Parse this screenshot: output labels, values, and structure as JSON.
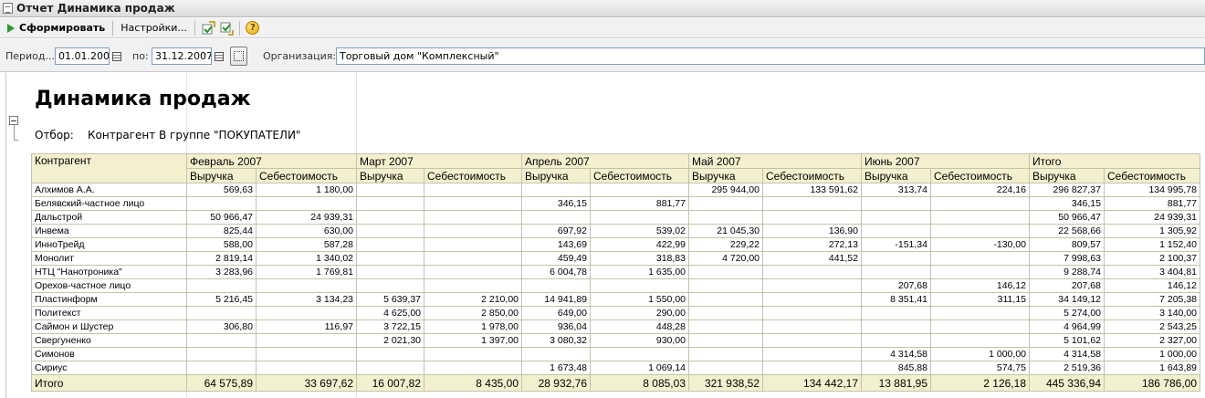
{
  "window": {
    "title": "Отчет  Динамика продаж"
  },
  "toolbar": {
    "generate_label": "Сформировать",
    "settings_label": "Настройки...",
    "help_glyph": "?"
  },
  "params": {
    "period_label": "Период...",
    "date_from": "01.01.2007",
    "to_label": "по:",
    "date_to": "31.12.2007",
    "org_label": "Организация:",
    "org_value": "Торговый дом \"Комплексный\""
  },
  "report": {
    "title": "Динамика продаж",
    "filter_label": "Отбор:",
    "filter_text": "Контрагент В группе \"ПОКУПАТЕЛИ\"",
    "counterparty_header": "Контрагент",
    "periods": [
      "Февраль 2007",
      "Март 2007",
      "Апрель 2007",
      "Май 2007",
      "Июнь 2007",
      "Итого"
    ],
    "subheaders": [
      "Выручка",
      "Себестоимость"
    ],
    "rows": [
      {
        "name": "Алхимов А.А.",
        "values": [
          "569,63",
          "1 180,00",
          "",
          "",
          "",
          "",
          "295 944,00",
          "133 591,62",
          "313,74",
          "224,16",
          "296 827,37",
          "134 995,78"
        ]
      },
      {
        "name": "Белявский-частное лицо",
        "values": [
          "",
          "",
          "",
          "",
          "346,15",
          "881,77",
          "",
          "",
          "",
          "",
          "346,15",
          "881,77"
        ]
      },
      {
        "name": "Дальстрой",
        "values": [
          "50 966,47",
          "24 939,31",
          "",
          "",
          "",
          "",
          "",
          "",
          "",
          "",
          "50 966,47",
          "24 939,31"
        ]
      },
      {
        "name": "Инвема",
        "values": [
          "825,44",
          "630,00",
          "",
          "",
          "697,92",
          "539,02",
          "21 045,30",
          "136,90",
          "",
          "",
          "22 568,66",
          "1 305,92"
        ]
      },
      {
        "name": "ИнноТрейд",
        "values": [
          "588,00",
          "587,28",
          "",
          "",
          "143,69",
          "422,99",
          "229,22",
          "272,13",
          "-151,34",
          "-130,00",
          "809,57",
          "1 152,40"
        ]
      },
      {
        "name": "Монолит",
        "values": [
          "2 819,14",
          "1 340,02",
          "",
          "",
          "459,49",
          "318,83",
          "4 720,00",
          "441,52",
          "",
          "",
          "7 998,63",
          "2 100,37"
        ]
      },
      {
        "name": "НТЦ \"Нанотроника\"",
        "values": [
          "3 283,96",
          "1 769,81",
          "",
          "",
          "6 004,78",
          "1 635,00",
          "",
          "",
          "",
          "",
          "9 288,74",
          "3 404,81"
        ]
      },
      {
        "name": "Орехов-частное лицо",
        "values": [
          "",
          "",
          "",
          "",
          "",
          "",
          "",
          "",
          "207,68",
          "146,12",
          "207,68",
          "146,12"
        ]
      },
      {
        "name": "Пластинформ",
        "values": [
          "5 216,45",
          "3 134,23",
          "5 639,37",
          "2 210,00",
          "14 941,89",
          "1 550,00",
          "",
          "",
          "8 351,41",
          "311,15",
          "34 149,12",
          "7 205,38"
        ]
      },
      {
        "name": "Политекст",
        "values": [
          "",
          "",
          "4 625,00",
          "2 850,00",
          "649,00",
          "290,00",
          "",
          "",
          "",
          "",
          "5 274,00",
          "3 140,00"
        ]
      },
      {
        "name": "Саймон и Шустер",
        "values": [
          "306,80",
          "116,97",
          "3 722,15",
          "1 978,00",
          "936,04",
          "448,28",
          "",
          "",
          "",
          "",
          "4 964,99",
          "2 543,25"
        ]
      },
      {
        "name": "Свергуненко",
        "values": [
          "",
          "",
          "2 021,30",
          "1 397,00",
          "3 080,32",
          "930,00",
          "",
          "",
          "",
          "",
          "5 101,62",
          "2 327,00"
        ]
      },
      {
        "name": "Симонов",
        "values": [
          "",
          "",
          "",
          "",
          "",
          "",
          "",
          "",
          "4 314,58",
          "1 000,00",
          "4 314,58",
          "1 000,00"
        ]
      },
      {
        "name": "Сириус",
        "values": [
          "",
          "",
          "",
          "",
          "1 673,48",
          "1 069,14",
          "",
          "",
          "845,88",
          "574,75",
          "2 519,36",
          "1 643,89"
        ]
      }
    ],
    "total": {
      "name": "Итого",
      "values": [
        "64 575,89",
        "33 697,62",
        "16 007,82",
        "8 435,00",
        "28 932,76",
        "8 085,03",
        "321 938,52",
        "134 442,17",
        "13 881,95",
        "2 126,18",
        "445 336,94",
        "186 786,00"
      ]
    }
  },
  "colors": {
    "header_bg": "#f4f0cf",
    "grid_border": "#c3c3aa",
    "play_green": "#2d9a2d"
  }
}
